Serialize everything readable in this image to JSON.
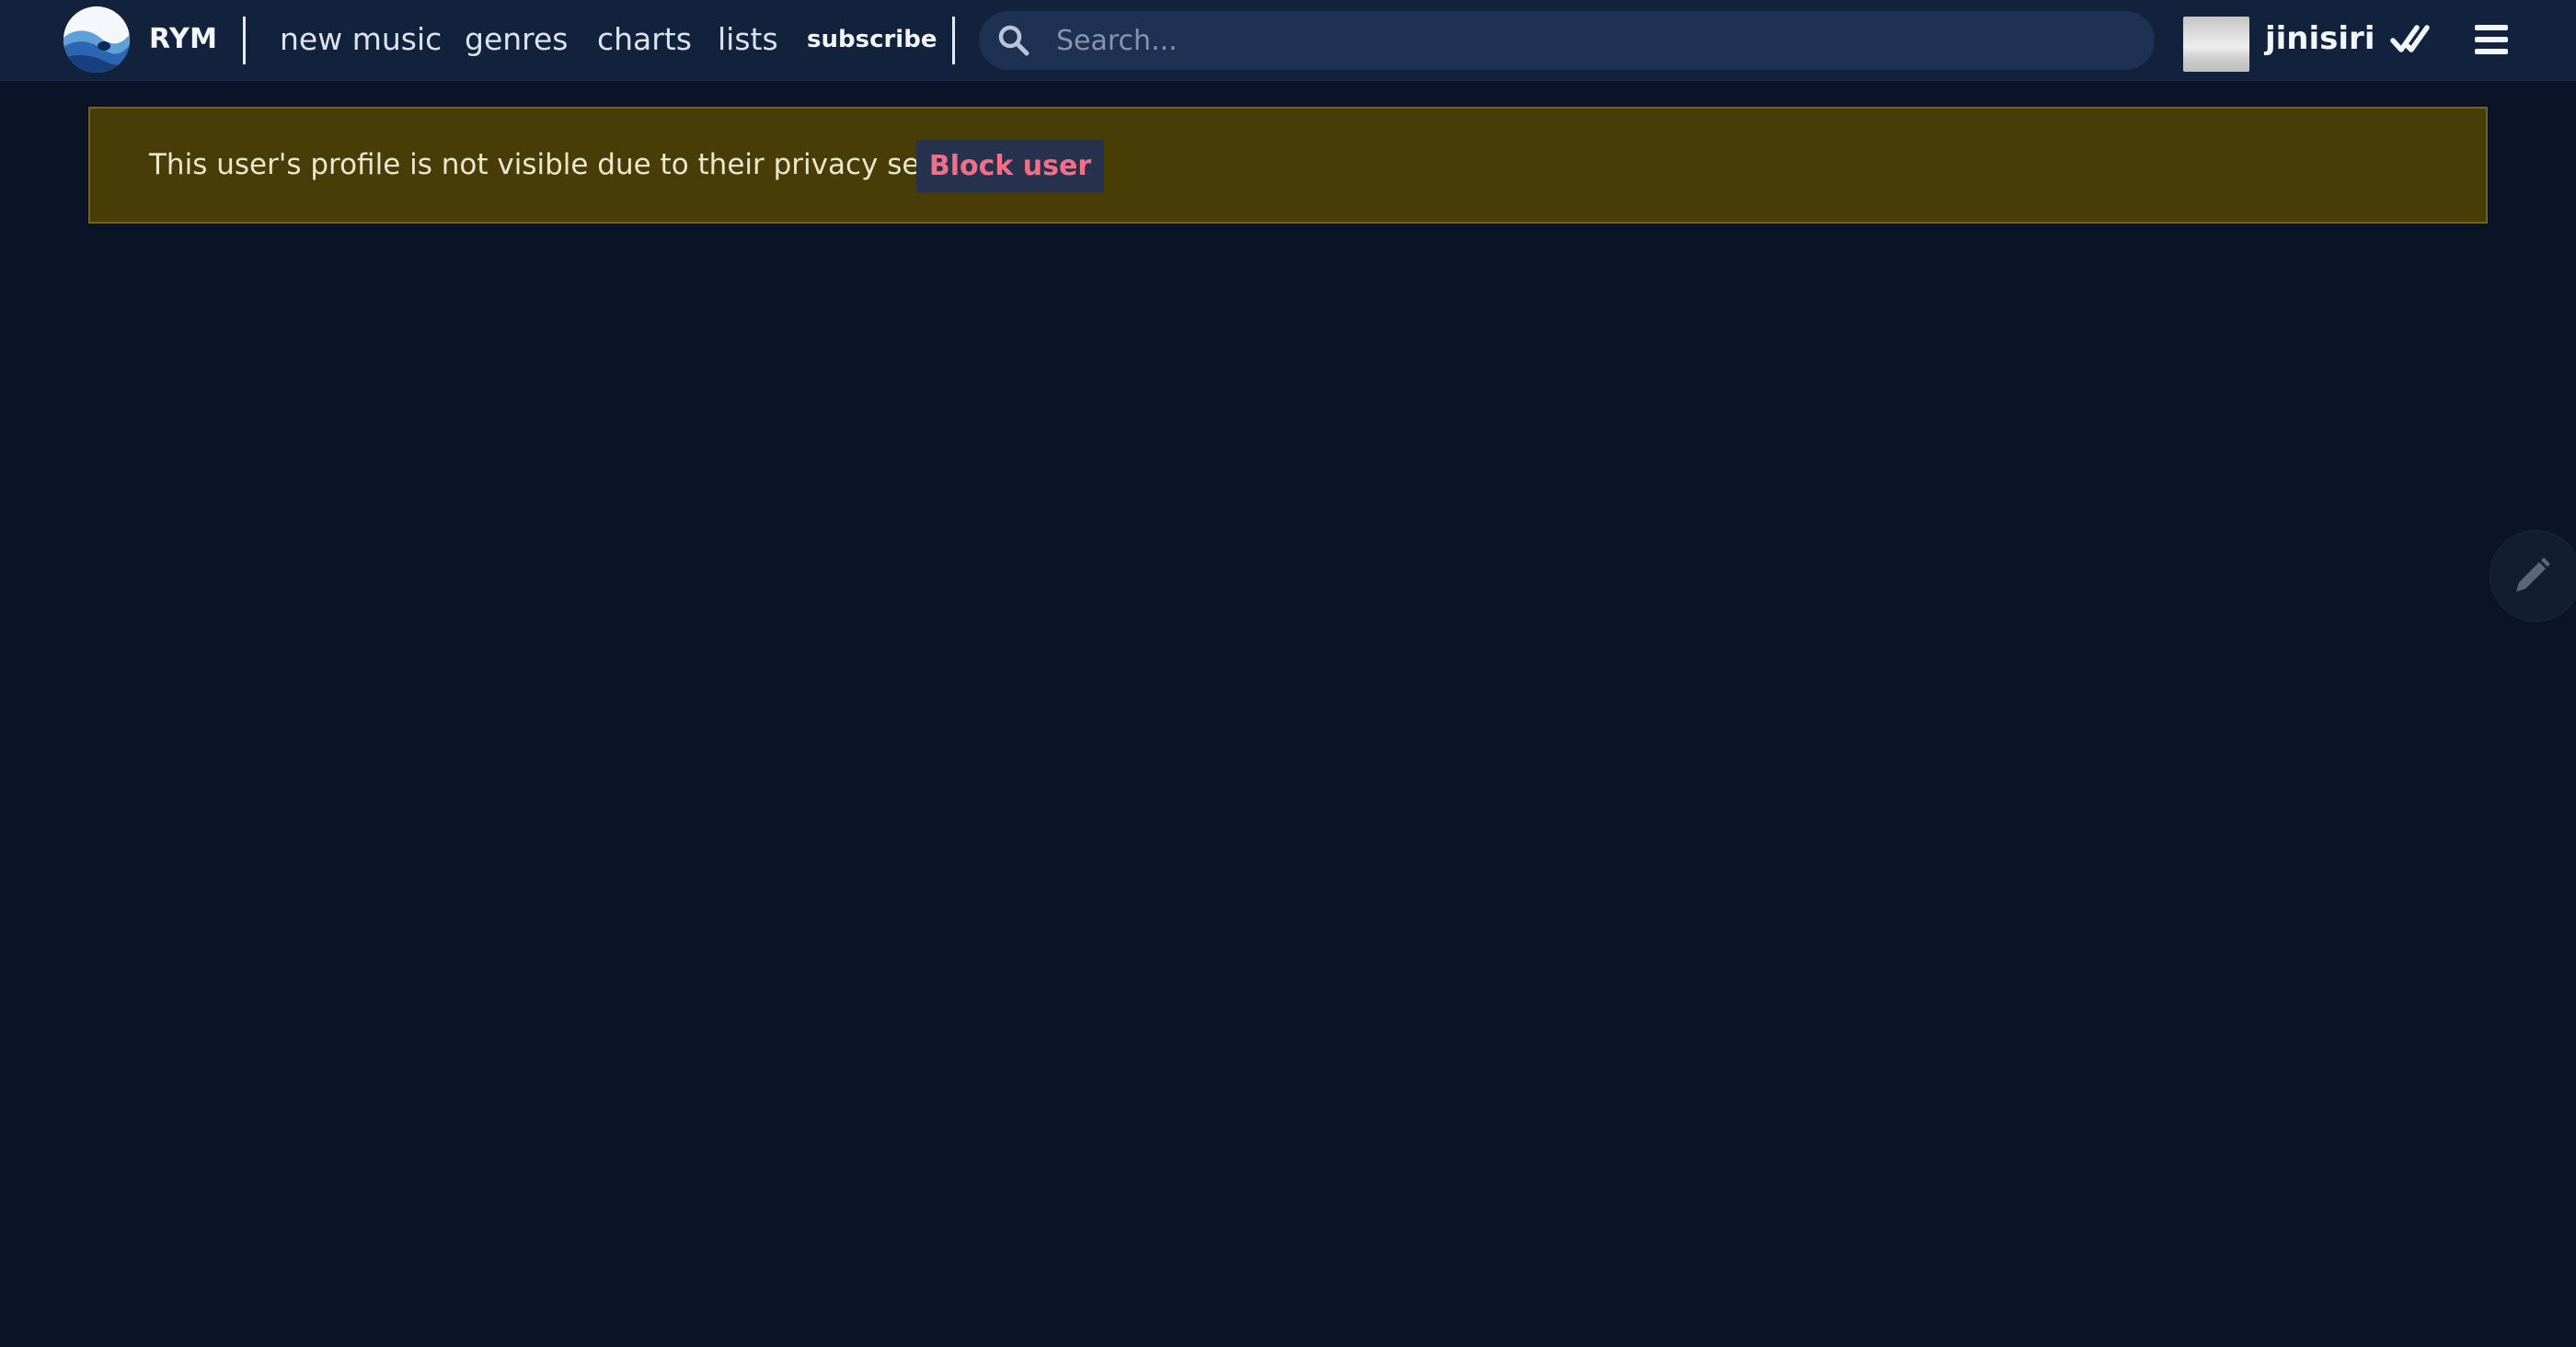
{
  "header": {
    "brand": "RYM",
    "nav": {
      "new_music": "new music",
      "genres": "genres",
      "charts": "charts",
      "lists": "lists",
      "subscribe": "subscribe"
    },
    "search": {
      "placeholder": "Search...",
      "value": ""
    },
    "user": {
      "username": "jinisiri"
    },
    "icons": {
      "logo": "rym-logo-icon",
      "search": "search-icon",
      "check": "double-check-icon",
      "menu": "hamburger-menu-icon"
    }
  },
  "notice": {
    "message": "This user's profile is not visible due to their privacy settings.",
    "block_label": "Block user"
  },
  "floating": {
    "edit_icon": "pencil-icon"
  },
  "colors": {
    "page_bg": "#0b1426",
    "header_bg": "#13223c",
    "search_bg": "#1e3152",
    "notice_bg": "#483d06",
    "notice_border": "#6b6231",
    "block_text": "#f07088",
    "block_bg": "#27324f"
  }
}
